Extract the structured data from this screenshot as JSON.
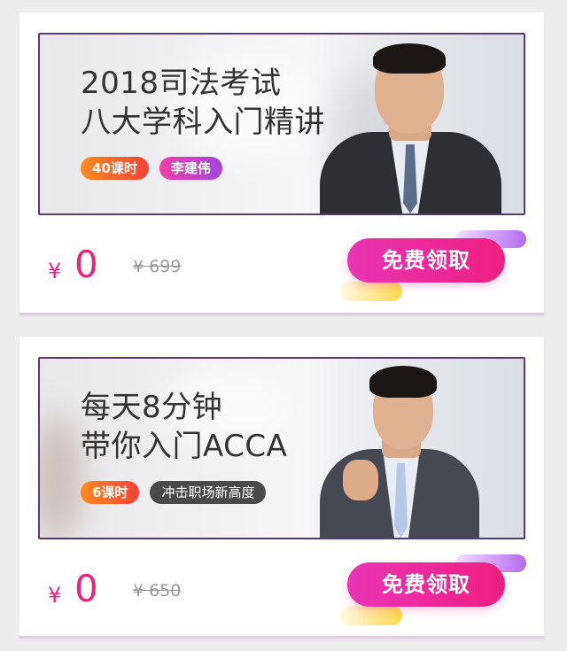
{
  "courses": [
    {
      "headline": [
        "2018司法考试",
        "八大学科入门精讲"
      ],
      "tags": [
        {
          "label": "40课时",
          "style": "orange"
        },
        {
          "label": "李建伟",
          "style": "pink"
        }
      ],
      "currency": "¥",
      "price": "0",
      "original_price": "¥ 699",
      "cta_label": "免费领取"
    },
    {
      "headline": [
        "每天8分钟",
        "带你入门ACCA"
      ],
      "tags": [
        {
          "label": "6课时",
          "style": "orange"
        },
        {
          "label": "冲击职场新高度",
          "style": "dark"
        }
      ],
      "currency": "¥",
      "price": "0",
      "original_price": "¥ 650",
      "cta_label": "免费领取"
    }
  ],
  "colors": {
    "accent_pink": "#e8267f",
    "banner_border": "#5b3a6e",
    "tag_orange": "#f5423b",
    "tag_pink": "#c044c8",
    "tag_dark": "#4a4a4a"
  },
  "icons": [
    "person-photo-lecturer",
    "person-photo-businessman"
  ]
}
